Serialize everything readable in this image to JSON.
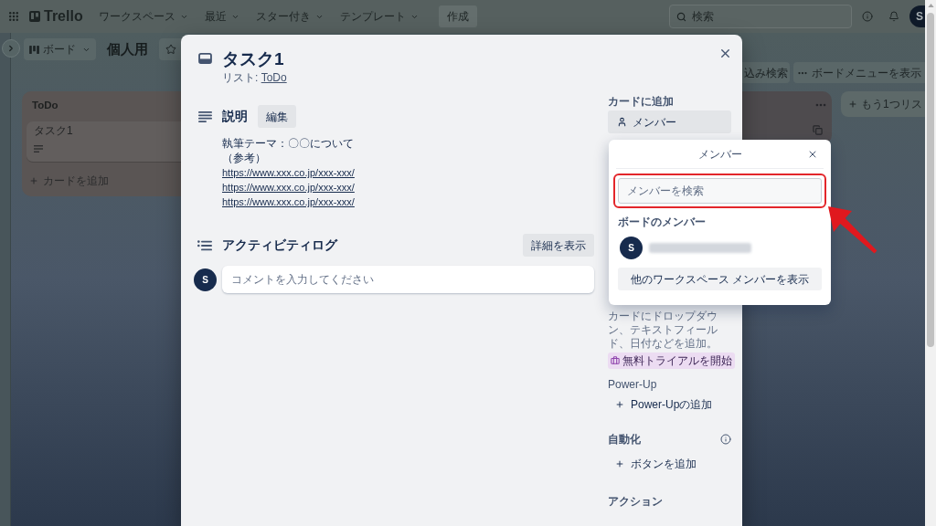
{
  "top_bar": {
    "logo": "Trello",
    "menus": [
      "ワークスペース",
      "最近",
      "スター付き",
      "テンプレート"
    ],
    "create_button": "作成",
    "search": {
      "placeholder": "検索"
    },
    "avatar": "S"
  },
  "board_header": {
    "switcher": "ボード",
    "title": "個人用",
    "filter_button": "込み検索",
    "menu_button": "ボードメニューを表示"
  },
  "lists": [
    {
      "title": "ToDo",
      "cards": [
        {
          "title": "タスク1",
          "has_description": true
        }
      ],
      "add_card": "カードを追加"
    }
  ],
  "add_list_button": "もう1つリス",
  "card_modal": {
    "title": "タスク1",
    "list_prefix": "リスト:",
    "list_link": "ToDo",
    "description": {
      "heading": "説明",
      "edit_button": "編集",
      "lines": [
        "執筆テーマ：〇〇について",
        "（参考）"
      ],
      "links": [
        "https://www.xxx.co.jp/xxx-xxx/",
        "https://www.xxx.co.jp/xxx-xxx/",
        "https://www.xxx.co.jp/xxx-xxx/"
      ]
    },
    "activity": {
      "heading": "アクティビティログ",
      "details_button": "詳細を表示",
      "avatar": "S",
      "comment": {
        "placeholder": "コメントを入力してください"
      }
    },
    "sidebar": {
      "add_to_card": {
        "heading": "カードに追加",
        "members_button": "メンバー"
      },
      "custom_fields_note": "カードにドロップダウン、テキストフィールド、日付などを追加。",
      "trial_button": "無料トライアルを開始",
      "power_ups": {
        "heading": "Power-Up",
        "add_button": "Power-Upの追加"
      },
      "automation": {
        "heading": "自動化",
        "add_button": "ボタンを追加"
      },
      "actions": {
        "heading": "アクション"
      }
    }
  },
  "member_popover": {
    "title": "メンバー",
    "search": {
      "placeholder": "メンバーを検索",
      "highlighted": true
    },
    "section_heading": "ボードのメンバー",
    "members": [
      {
        "avatar": "S"
      }
    ],
    "more_button": "他のワークスペース メンバーを表示"
  },
  "pointer_arrow": true
}
